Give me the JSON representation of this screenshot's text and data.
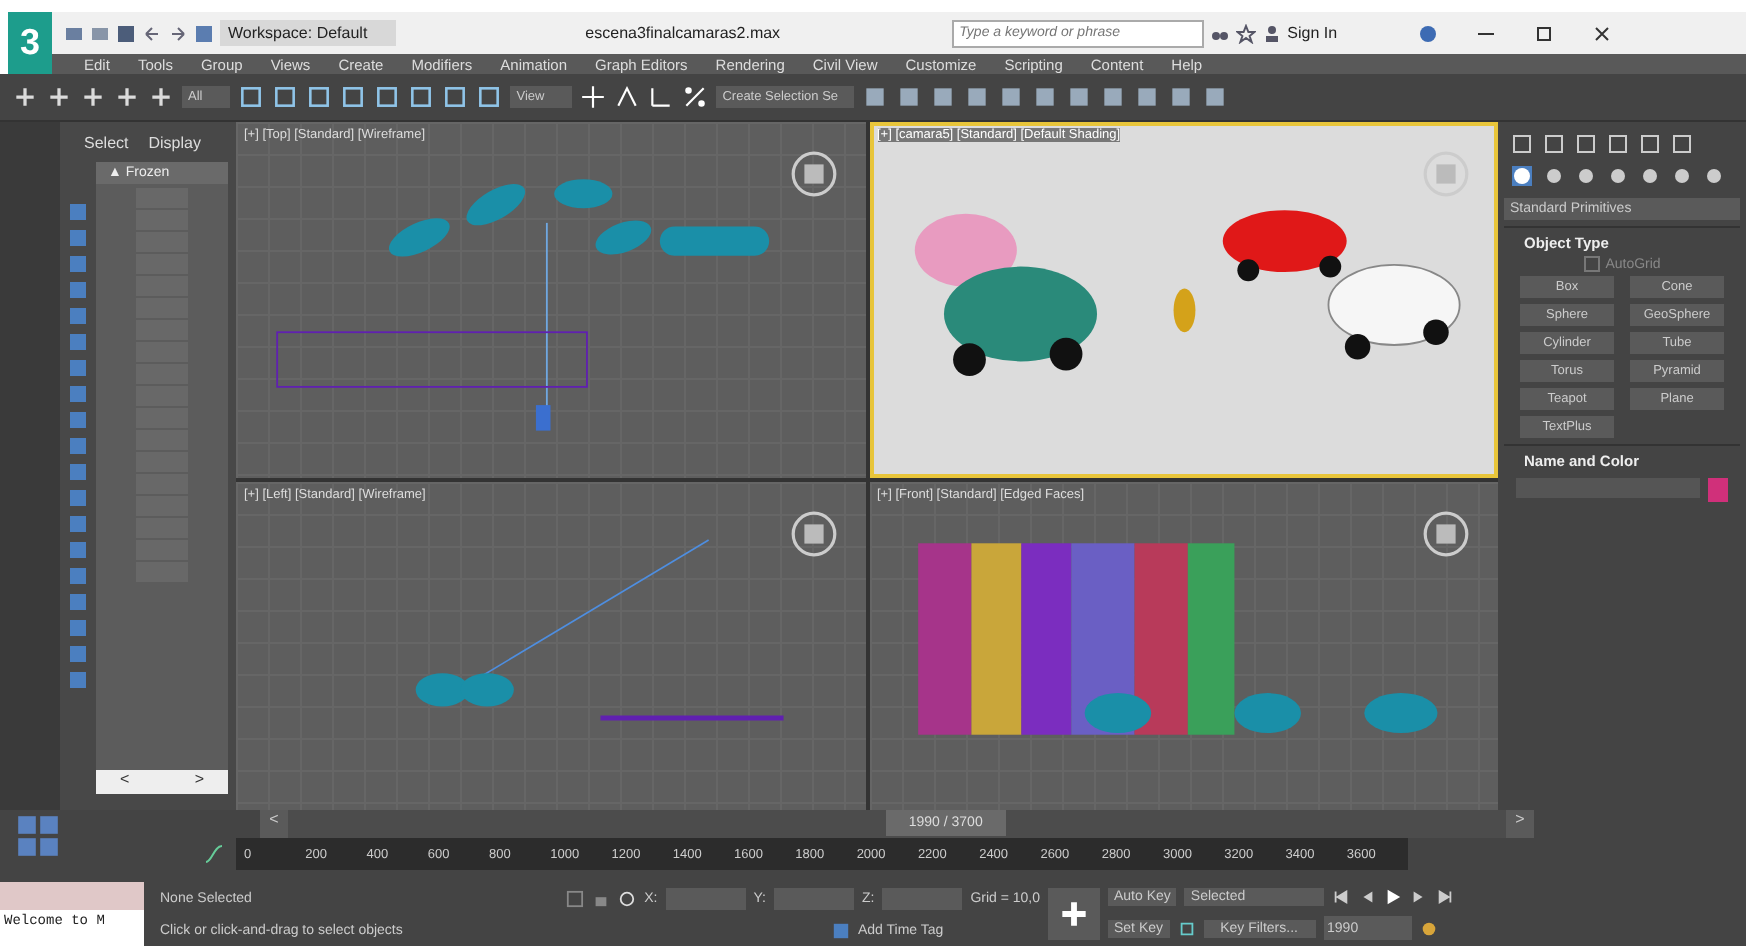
{
  "title_bar": {
    "logo": "3",
    "workspace": "Workspace: Default",
    "file_name": "escena3finalcamaras2.max",
    "search": {
      "placeholder": "Type a keyword or phrase"
    },
    "sign_in": "Sign In"
  },
  "menu": [
    "Edit",
    "Tools",
    "Group",
    "Views",
    "Create",
    "Modifiers",
    "Animation",
    "Graph Editors",
    "Rendering",
    "Civil View",
    "Customize",
    "Scripting",
    "Content",
    "Help"
  ],
  "toolbar": {
    "selection_filter": "All",
    "reference_coordinate": "View",
    "named_selection": "Create Selection Se"
  },
  "scene_explorer": {
    "tabs": [
      "Select",
      "Display"
    ],
    "column_header": "▲ Frozen",
    "scroll_left": "<",
    "scroll_right": ">"
  },
  "viewports": [
    {
      "kind": "top",
      "label": "[+] [Top] [Standard] [Wireframe]",
      "active": false
    },
    {
      "kind": "camera",
      "label": "[+] [camara5] [Standard] [Default Shading]",
      "active": true
    },
    {
      "kind": "left",
      "label": "[+] [Left] [Standard] [Wireframe]",
      "active": false
    },
    {
      "kind": "front",
      "label": "[+] [Front] [Standard] [Edged Faces]",
      "active": false
    }
  ],
  "command_panel": {
    "category": "Standard Primitives",
    "object_type": {
      "title": "Object Type",
      "autogrid": {
        "label": "AutoGrid",
        "checked": false
      },
      "buttons": [
        "Box",
        "Cone",
        "Sphere",
        "GeoSphere",
        "Cylinder",
        "Tube",
        "Torus",
        "Pyramid",
        "Teapot",
        "Plane",
        "TextPlus"
      ]
    },
    "name_and_color": {
      "title": "Name and Color",
      "color": "#d0307a"
    }
  },
  "timeline": {
    "frame": "1990 / 3700",
    "level": 0.54,
    "prev": "<",
    "next": ">",
    "ticks": [
      "0",
      "200",
      "400",
      "600",
      "800",
      "1000",
      "1200",
      "1400",
      "1600",
      "1800",
      "2000",
      "2200",
      "2400",
      "2600",
      "2800",
      "3000",
      "3200",
      "3400",
      "3600"
    ]
  },
  "status": {
    "listener": "Welcome to M",
    "selection": "None Selected",
    "prompt": "Click or click-and-drag to select objects",
    "x_label": "X:",
    "y_label": "Y:",
    "z_label": "Z:",
    "grid": "Grid = 10,0",
    "time_tag": "Add Time Tag",
    "auto_key": "Auto Key",
    "key_mode": "Selected",
    "set_key": "Set Key",
    "key_filters": "Key Filters...",
    "current_frame": "1990"
  }
}
